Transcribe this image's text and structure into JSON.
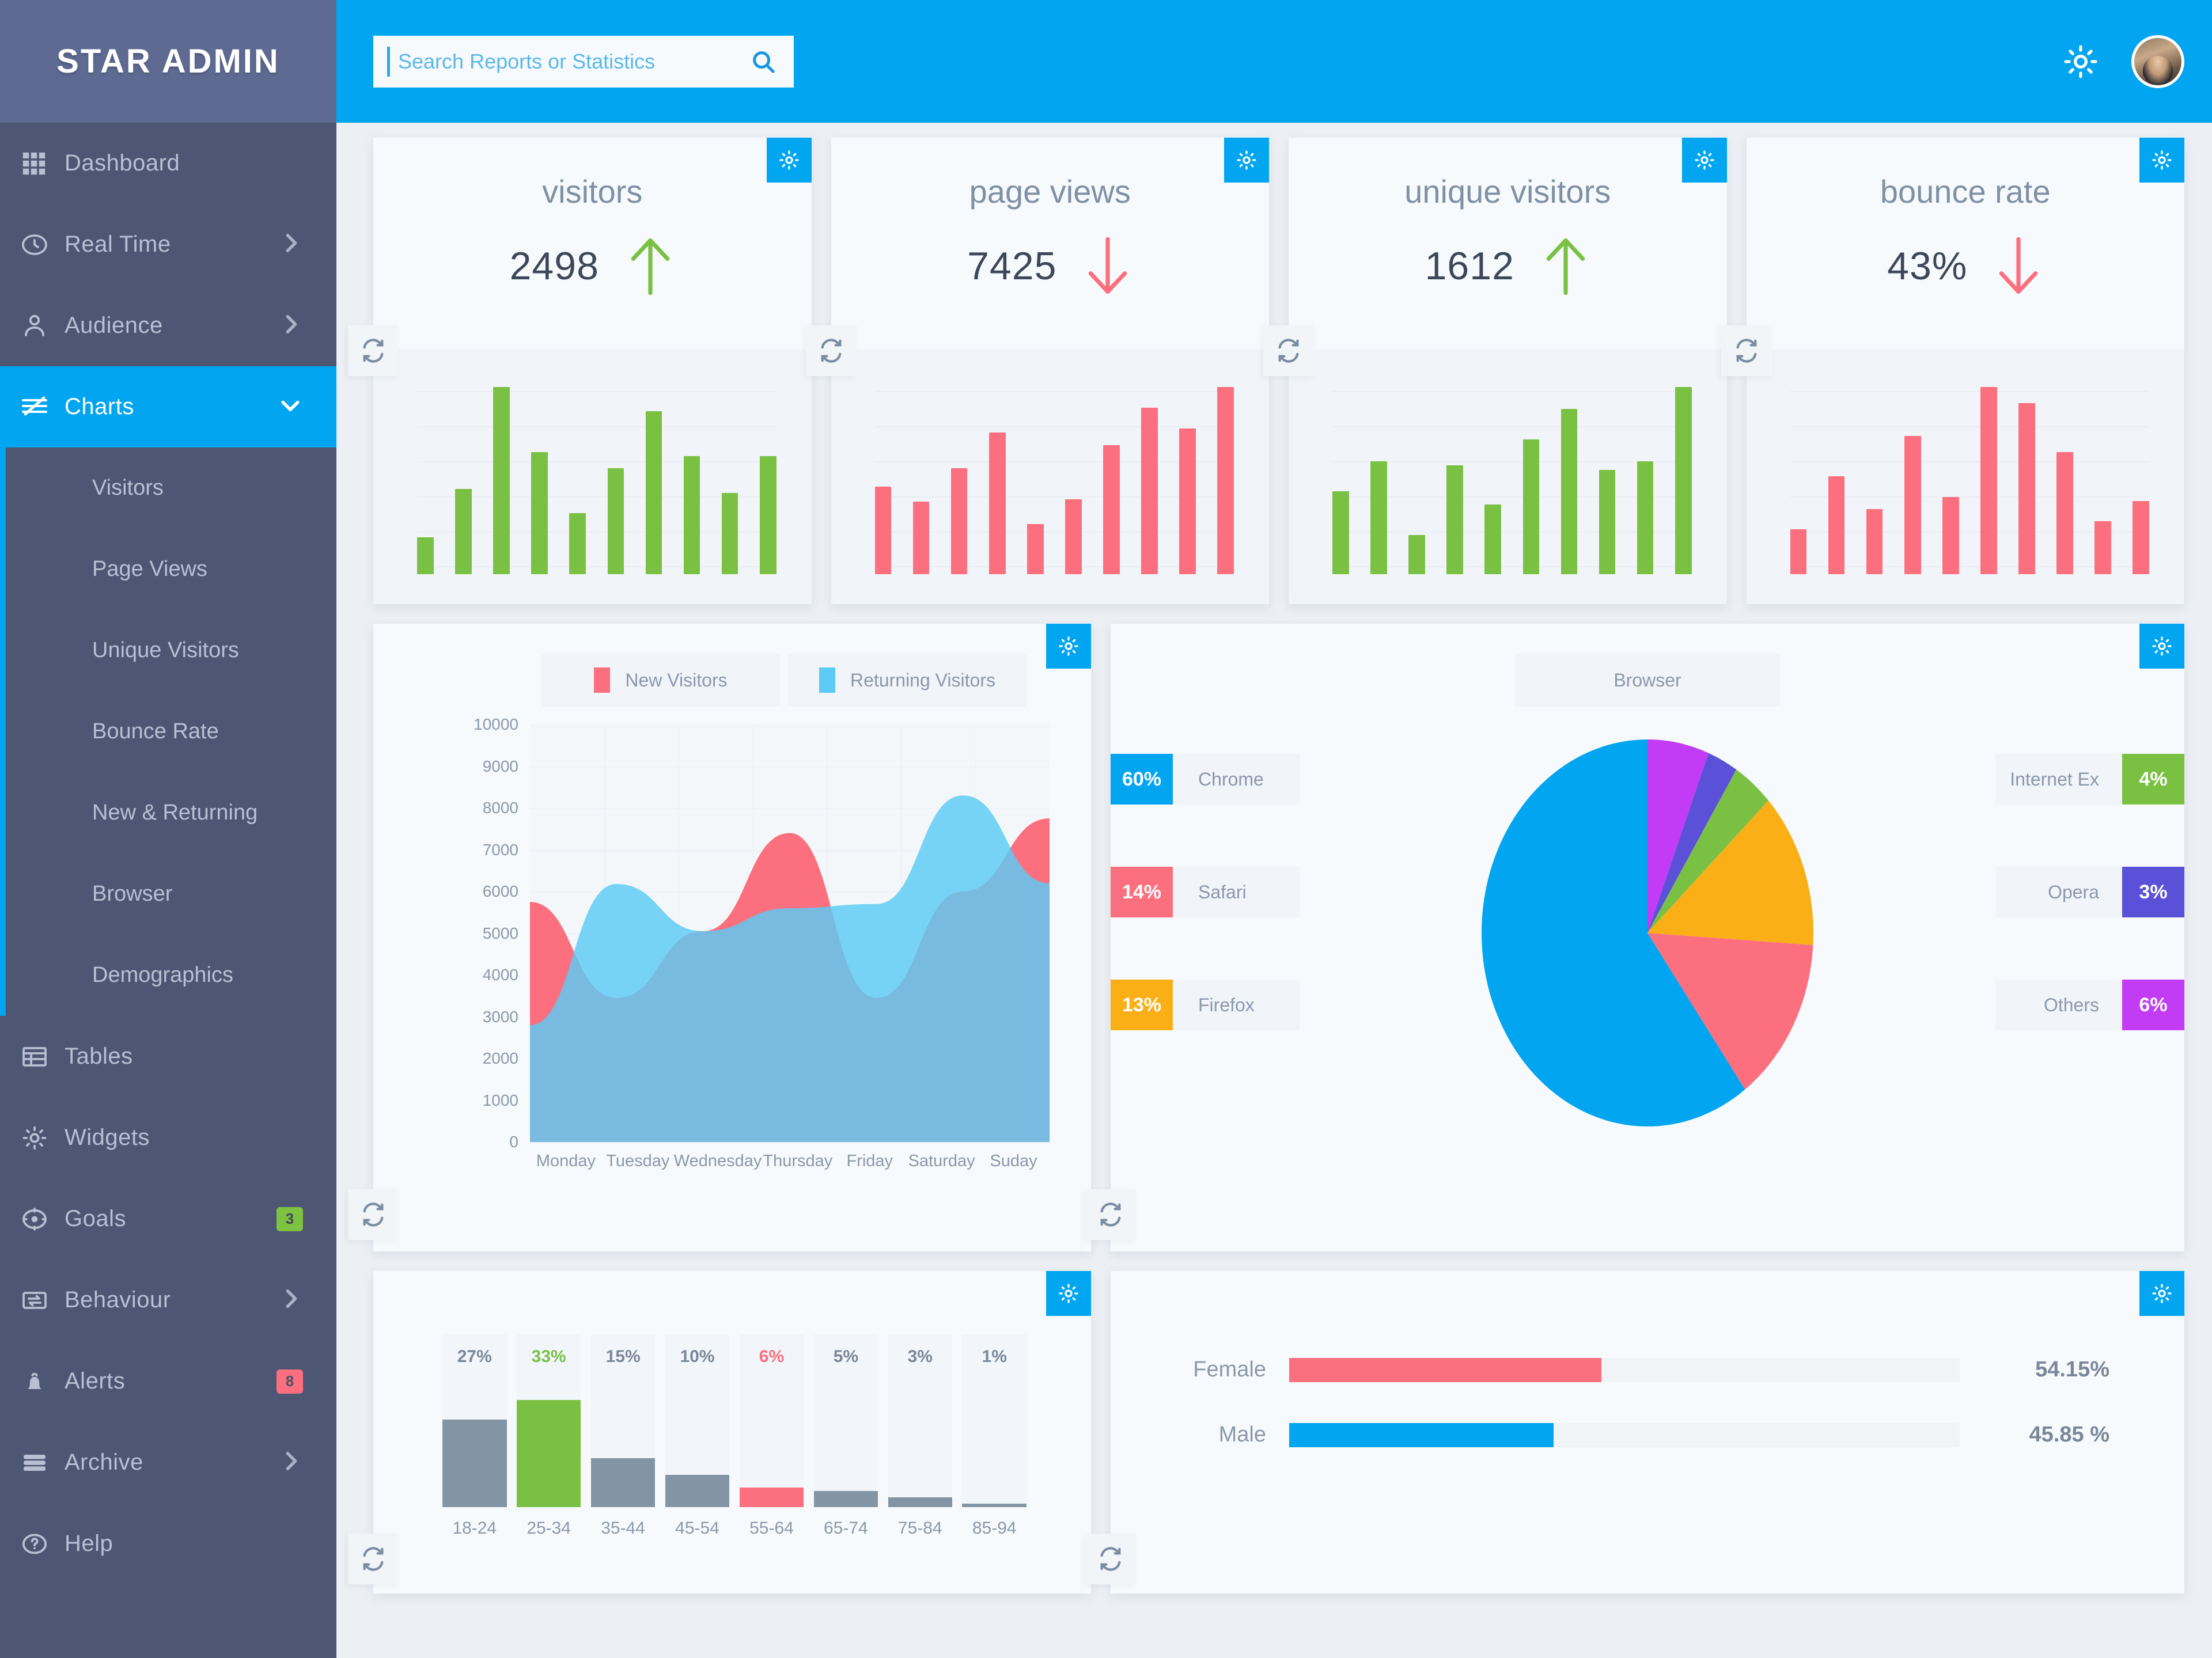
{
  "brand": {
    "title": "STAR ADMIN"
  },
  "search": {
    "placeholder": "Search Reports or Statistics",
    "value": ""
  },
  "sidebar": {
    "items": [
      {
        "label": "Dashboard",
        "icon": "grid-icon",
        "arrow": "",
        "badge": null,
        "active": false
      },
      {
        "label": "Real Time",
        "icon": "clock-icon",
        "arrow": ">",
        "badge": null,
        "active": false
      },
      {
        "label": "Audience",
        "icon": "user-icon",
        "arrow": ">",
        "badge": null,
        "active": false
      },
      {
        "label": "Charts",
        "icon": "chart-icon",
        "arrow": "v",
        "badge": null,
        "active": true
      },
      {
        "label": "Tables",
        "icon": "table-icon",
        "arrow": "",
        "badge": null,
        "active": false
      },
      {
        "label": "Widgets",
        "icon": "gear-icon",
        "arrow": "",
        "badge": null,
        "active": false
      },
      {
        "label": "Goals",
        "icon": "target-icon",
        "arrow": "",
        "badge": "3",
        "badge_color": "green",
        "active": false
      },
      {
        "label": "Behaviour",
        "icon": "exchange-icon",
        "arrow": ">",
        "badge": null,
        "active": false
      },
      {
        "label": "Alerts",
        "icon": "bell-icon",
        "arrow": "",
        "badge": "8",
        "badge_color": "red",
        "active": false
      },
      {
        "label": "Archive",
        "icon": "archive-icon",
        "arrow": ">",
        "badge": null,
        "active": false
      },
      {
        "label": "Help",
        "icon": "help-icon",
        "arrow": "",
        "badge": null,
        "active": false
      }
    ],
    "submenu": [
      {
        "label": "Visitors"
      },
      {
        "label": "Page Views"
      },
      {
        "label": "Unique Visitors"
      },
      {
        "label": "Bounce Rate"
      },
      {
        "label": "New & Returning"
      },
      {
        "label": "Browser"
      },
      {
        "label": "Demographics"
      }
    ]
  },
  "colors": {
    "accent": "#01a5f0",
    "green": "#7ac143",
    "red": "#fc6f7e",
    "blue_light": "#5ccbf5",
    "blue_mid": "#6aa6d8",
    "orange": "#fbaf17",
    "purple": "#5b51d8",
    "magenta": "#c13cf4",
    "gray": "#8394a5",
    "sidebar": "#4d5673",
    "brand_bg": "#5e6a92"
  },
  "chart_data": [
    {
      "type": "bar",
      "id": "visitors-sparkline",
      "title": "visitors",
      "value": "2498",
      "trend": "up",
      "trend_color": "#7ac143",
      "color": "#7ac143",
      "values": [
        18,
        42,
        92,
        60,
        30,
        52,
        80,
        58,
        40,
        58
      ],
      "ylim": [
        0,
        100
      ]
    },
    {
      "type": "bar",
      "id": "pageviews-sparkline",
      "title": "page views",
      "value": "7425",
      "trend": "down",
      "trend_color": "#fc6f7e",
      "color": "#fc6f7e",
      "values": [
        42,
        35,
        51,
        68,
        24,
        36,
        62,
        80,
        70,
        90
      ],
      "ylim": [
        0,
        100
      ]
    },
    {
      "type": "bar",
      "id": "unique-visitors-sparkline",
      "title": "unique visitors",
      "value": "1612",
      "trend": "up",
      "trend_color": "#7ac143",
      "color": "#7ac143",
      "values": [
        38,
        52,
        18,
        50,
        32,
        62,
        76,
        48,
        52,
        86
      ],
      "ylim": [
        0,
        100
      ]
    },
    {
      "type": "bar",
      "id": "bounce-rate-sparkline",
      "title": "bounce rate",
      "value": "43%",
      "trend": "down",
      "trend_color": "#fc6f7e",
      "color": "#fc6f7e",
      "values": [
        22,
        48,
        32,
        68,
        38,
        92,
        84,
        60,
        26,
        36
      ],
      "ylim": [
        0,
        100
      ]
    },
    {
      "type": "area",
      "id": "new-returning-area",
      "title": "",
      "xlabel": "",
      "ylabel": "",
      "categories": [
        "Monday",
        "Tuesday",
        "Wednesday",
        "Thursday",
        "Friday",
        "Saturday",
        "Suday"
      ],
      "ylim": [
        0,
        10000
      ],
      "yticks": [
        0,
        1000,
        2000,
        3000,
        4000,
        5000,
        6000,
        7000,
        8000,
        9000,
        10000
      ],
      "grid": true,
      "legend_position": "top",
      "series": [
        {
          "name": "New Visitors",
          "color": "#fc6f7e",
          "values": [
            5750,
            3450,
            5050,
            7400,
            3450,
            6000,
            7750
          ]
        },
        {
          "name": "Returning Visitors",
          "color": "#5ccbf5",
          "values": [
            2800,
            6180,
            5050,
            5600,
            5700,
            8300,
            6200
          ]
        }
      ]
    },
    {
      "type": "pie",
      "id": "browser-pie",
      "title": "Browser",
      "legend_position": "sides",
      "slices": [
        {
          "label": "Chrome",
          "value": 60,
          "display": "60%",
          "color": "#01a5f0"
        },
        {
          "label": "Safari",
          "value": 14,
          "display": "14%",
          "color": "#fc6f7e"
        },
        {
          "label": "Firefox",
          "value": 13,
          "display": "13%",
          "color": "#fbaf17"
        },
        {
          "label": "Internet Ex",
          "value": 4,
          "display": "4%",
          "color": "#7ac143"
        },
        {
          "label": "Opera",
          "value": 3,
          "display": "3%",
          "color": "#5b51d8"
        },
        {
          "label": "Others",
          "value": 6,
          "display": "6%",
          "color": "#c13cf4"
        }
      ]
    },
    {
      "type": "bar",
      "id": "age-demographics",
      "title": "",
      "categories": [
        "18-24",
        "25-34",
        "35-44",
        "45-54",
        "55-64",
        "65-74",
        "75-84",
        "85-94"
      ],
      "values": [
        27,
        33,
        15,
        10,
        6,
        5,
        3,
        1
      ],
      "labels": [
        "27%",
        "33%",
        "15%",
        "10%",
        "6%",
        "5%",
        "3%",
        "1%"
      ],
      "bar_colors": [
        "#8394a5",
        "#7ac143",
        "#8394a5",
        "#8394a5",
        "#fc6f7e",
        "#8394a5",
        "#8394a5",
        "#8394a5"
      ],
      "label_colors": [
        "#7a8798",
        "#7ac143",
        "#7a8798",
        "#7a8798",
        "#fc6f7e",
        "#7a8798",
        "#7a8798",
        "#7a8798"
      ],
      "ylim": [
        0,
        33
      ]
    },
    {
      "type": "bar",
      "id": "gender-split",
      "orientation": "horizontal",
      "categories": [
        "Female",
        "Male"
      ],
      "values": [
        54.15,
        45.85
      ],
      "labels": [
        "54.15%",
        "45.85 %"
      ],
      "bar_colors": [
        "#fc6f7e",
        "#01a5f0"
      ],
      "ylim": [
        0,
        100
      ]
    }
  ]
}
